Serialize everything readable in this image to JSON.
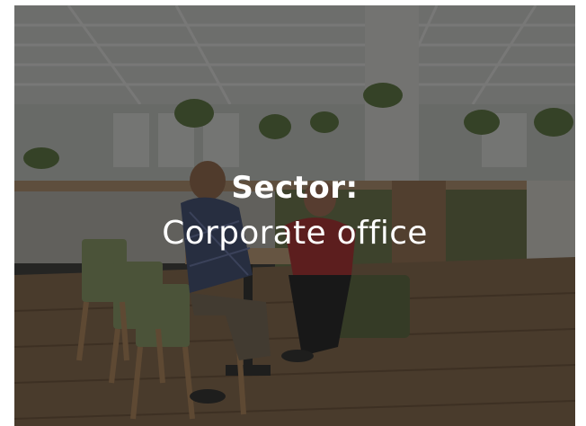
{
  "card": {
    "label": "Sector:",
    "value": "Corporate office"
  },
  "colors": {
    "overlay": "#141414",
    "text": "#ffffff",
    "wood": "#7a5a3c",
    "seat_green": "#6f7a4a"
  }
}
